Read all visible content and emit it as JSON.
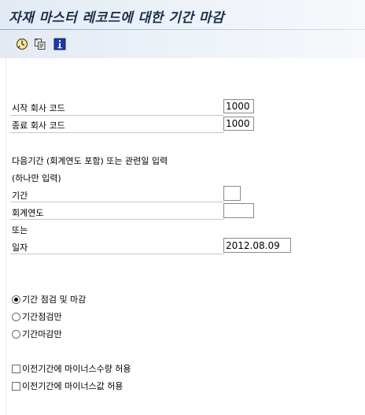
{
  "title": "자재 마스터 레코드에 대한 기간 마감",
  "toolbar": {
    "buttons": [
      {
        "icon": "execute-icon"
      },
      {
        "icon": "copy-variant-icon"
      },
      {
        "icon": "info-icon"
      }
    ]
  },
  "company": {
    "start_label": "시작 회사 코드",
    "start_value": "1000",
    "end_label": "종료 회사 코드",
    "end_value": "1000"
  },
  "period": {
    "intro": "다음기간 (회계연도 포함) 또는 관련일 입력",
    "only_one": "(하나만 입력)",
    "period_label": "기간",
    "period_value": "",
    "year_label": "회계연도",
    "year_value": "",
    "or_label": "또는",
    "date_label": "일자",
    "date_value": "2012.08.09"
  },
  "options": {
    "radios": [
      {
        "label": "기간 점검 및 마감",
        "selected": true
      },
      {
        "label": "기간점검만",
        "selected": false
      },
      {
        "label": "기간마감만",
        "selected": false
      }
    ],
    "checkboxes": [
      {
        "label": "이전기간에 마이너스수량 허용",
        "checked": false
      },
      {
        "label": "이전기간에 마이너스값 허용",
        "checked": false
      }
    ]
  }
}
